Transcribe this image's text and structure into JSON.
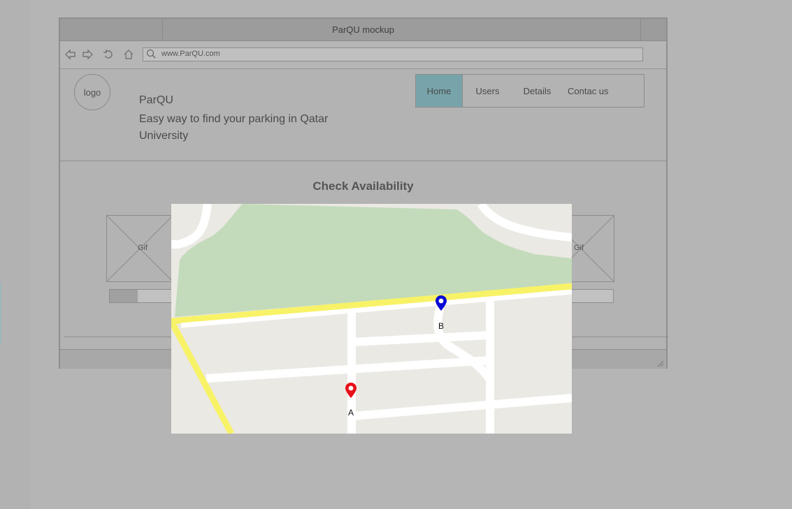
{
  "window": {
    "title": "ParQU mockup"
  },
  "browser": {
    "url": "www.ParQU.com"
  },
  "header": {
    "logo_text": "logo",
    "app_name": "ParQU",
    "tagline": "Easy way to find your parking in Qatar University"
  },
  "nav": {
    "items": [
      {
        "label": "Home"
      },
      {
        "label": "Users"
      },
      {
        "label": "Details"
      },
      {
        "label": "Contac us"
      }
    ]
  },
  "main": {
    "title": "Check Availability",
    "gif_left_label": "Gif",
    "gif_right_label": "Gif",
    "progress_left": 0.38,
    "progress_right": 0.08
  },
  "map": {
    "marker_a_label": "A",
    "marker_b_label": "B"
  },
  "colors": {
    "active_tab": "#77a4aa",
    "park": "#c3dbbb",
    "major_road": "#f8f267",
    "minor_road": "#ffffff",
    "map_background": "#ebe9e4",
    "marker_a": "#e8101a",
    "marker_b": "#0a0ad6"
  },
  "icons": [
    "back-arrow-icon",
    "forward-arrow-icon",
    "refresh-icon",
    "home-icon",
    "search-icon",
    "resize-grip-icon",
    "map-pin-icon"
  ]
}
